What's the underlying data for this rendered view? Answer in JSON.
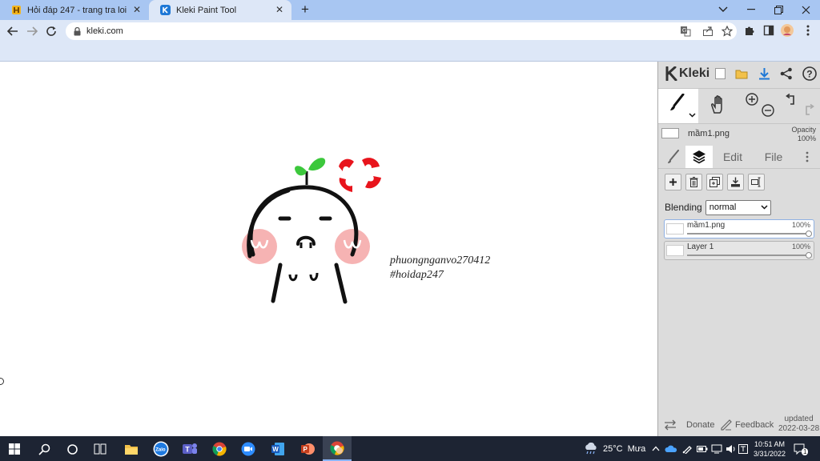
{
  "browser": {
    "tabs": [
      {
        "title": "Hỏi đáp 247 - trang tra loi",
        "favicon": "hoidap-favicon"
      },
      {
        "title": "Kleki Paint Tool",
        "favicon": "kleki-favicon",
        "active": true
      }
    ],
    "address": {
      "url": "kleki.com"
    }
  },
  "canvas": {
    "signature_line1": "phuongnganvo270412",
    "signature_line2": "#hoidap247"
  },
  "kleki": {
    "logo_text": "Kleki",
    "current_file": "mầm1.png",
    "opacity_label": "Opacity",
    "opacity_value": "100%",
    "tabs": {
      "edit": "Edit",
      "file": "File"
    },
    "blending_label": "Blending",
    "blending_value": "normal",
    "layers": [
      {
        "name": "mầm1.png",
        "opacity": "100%",
        "selected": true
      },
      {
        "name": "Layer 1",
        "opacity": "100%",
        "selected": false
      }
    ],
    "footer": {
      "donate": "Donate",
      "feedback": "Feedback",
      "updated_label": "updated",
      "updated_date": "2022-03-28"
    }
  },
  "taskbar": {
    "weather_temp": "25°C",
    "weather_text": "Mưa",
    "time": "10:51 AM",
    "date": "3/31/2022",
    "notif_count": "1"
  },
  "colors": {
    "tab_strip": "#a8c6f2",
    "toolbar": "#dde7f7",
    "panel": "#dcdcdc",
    "accent_blue": "#1e78d6",
    "sprout_green": "#3cc83c",
    "angry_red": "#e8141c",
    "cheek_pink": "#f4a6a6"
  }
}
